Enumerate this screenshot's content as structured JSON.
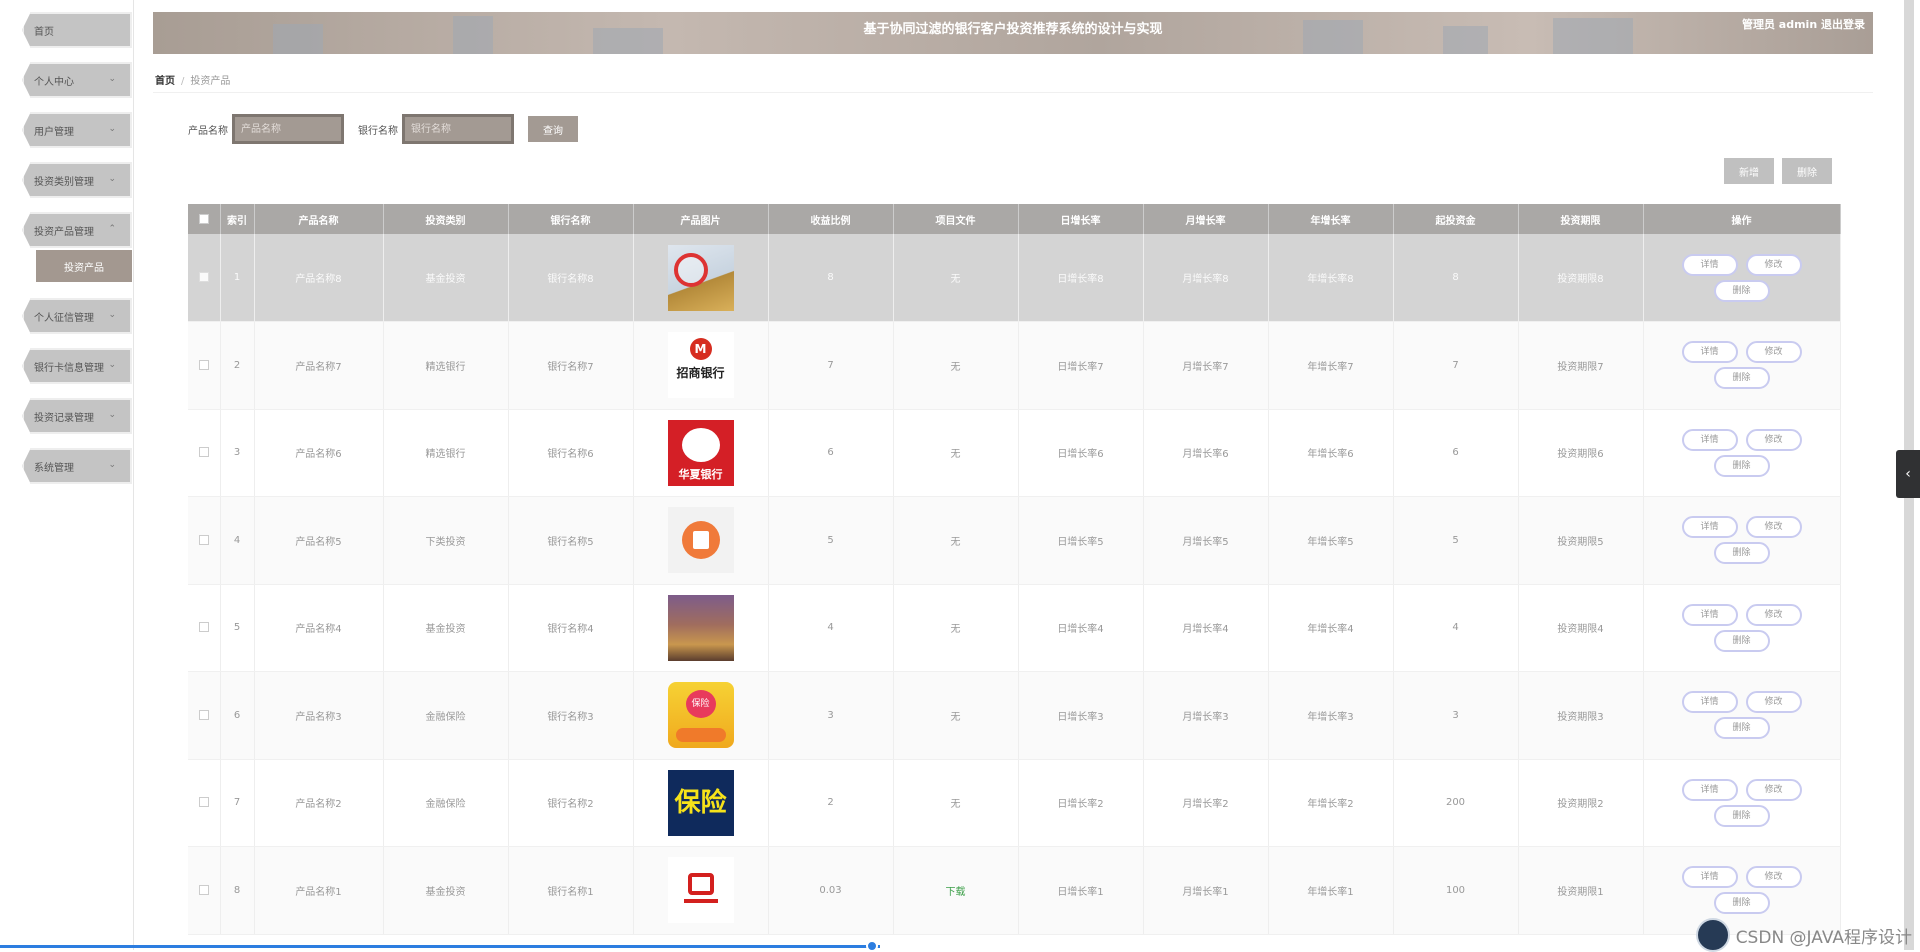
{
  "header": {
    "title": "基于协同过滤的银行客户投资推荐系统的设计与实现",
    "user": "管理员 admin  退出登录"
  },
  "sidebar": {
    "items": [
      {
        "label": "首页",
        "has_chevron": false
      },
      {
        "label": "个人中心",
        "has_chevron": true
      },
      {
        "label": "用户管理",
        "has_chevron": true
      },
      {
        "label": "投资类别管理",
        "has_chevron": true
      },
      {
        "label": "投资产品管理",
        "has_chevron": true,
        "expanded": true
      },
      {
        "label": "个人征信管理",
        "has_chevron": true
      },
      {
        "label": "银行卡信息管理",
        "has_chevron": true
      },
      {
        "label": "投资记录管理",
        "has_chevron": true
      },
      {
        "label": "系统管理",
        "has_chevron": true
      }
    ],
    "sub_item": "投资产品"
  },
  "breadcrumb": {
    "home": "首页",
    "current": "投资产品"
  },
  "search": {
    "product_label": "产品名称",
    "product_placeholder": "产品名称",
    "bank_label": "银行名称",
    "bank_placeholder": "银行名称",
    "button": "查询"
  },
  "toolbar": {
    "add": "新增",
    "delete": "删除"
  },
  "table": {
    "headers": [
      "索引",
      "产品名称",
      "投资类别",
      "银行名称",
      "产品图片",
      "收益比例",
      "项目文件",
      "日增长率",
      "月增长率",
      "年增长率",
      "起投资金",
      "投资期限",
      "操作"
    ],
    "actions": {
      "detail": "详情",
      "edit": "修改",
      "delete": "删除"
    },
    "rows": [
      {
        "index": "1",
        "name": "产品名称8",
        "category": "基金投资",
        "bank": "银行名称8",
        "image": "coins-image",
        "ratio": "8",
        "file": "无",
        "daily": "日增长率8",
        "monthly": "月增长率8",
        "yearly": "年增长率8",
        "min": "8",
        "term": "投资期限8"
      },
      {
        "index": "2",
        "name": "产品名称7",
        "category": "精选银行",
        "bank": "银行名称7",
        "image": "cmb-logo",
        "ratio": "7",
        "file": "无",
        "daily": "日增长率7",
        "monthly": "月增长率7",
        "yearly": "年增长率7",
        "min": "7",
        "term": "投资期限7"
      },
      {
        "index": "3",
        "name": "产品名称6",
        "category": "精选银行",
        "bank": "银行名称6",
        "image": "hxb-logo",
        "ratio": "6",
        "file": "无",
        "daily": "日增长率6",
        "monthly": "月增长率6",
        "yearly": "年增长率6",
        "min": "6",
        "term": "投资期限6"
      },
      {
        "index": "4",
        "name": "产品名称5",
        "category": "下类投资",
        "bank": "银行名称5",
        "image": "orange-app-icon",
        "ratio": "5",
        "file": "无",
        "daily": "日增长率5",
        "monthly": "月增长率5",
        "yearly": "年增长率5",
        "min": "5",
        "term": "投资期限5"
      },
      {
        "index": "5",
        "name": "产品名称4",
        "category": "基金投资",
        "bank": "银行名称4",
        "image": "coins-stack-image",
        "ratio": "4",
        "file": "无",
        "daily": "日增长率4",
        "monthly": "月增长率4",
        "yearly": "年增长率4",
        "min": "4",
        "term": "投资期限4"
      },
      {
        "index": "6",
        "name": "产品名称3",
        "category": "金融保险",
        "bank": "银行名称3",
        "image": "insurance-heart-icon",
        "ratio": "3",
        "file": "无",
        "daily": "日增长率3",
        "monthly": "月增长率3",
        "yearly": "年增长率3",
        "min": "3",
        "term": "投资期限3"
      },
      {
        "index": "7",
        "name": "产品名称2",
        "category": "金融保险",
        "bank": "银行名称2",
        "image": "baoxian-text-image",
        "ratio": "2",
        "file": "无",
        "daily": "日增长率2",
        "monthly": "月增长率2",
        "yearly": "年增长率2",
        "min": "200",
        "term": "投资期限2"
      },
      {
        "index": "8",
        "name": "产品名称1",
        "category": "基金投资",
        "bank": "银行名称1",
        "image": "bank-logo-red",
        "ratio": "0.03",
        "file": "下载",
        "daily": "日增长率1",
        "monthly": "月增长率1",
        "yearly": "年增长率1",
        "min": "100",
        "term": "投资期限1"
      }
    ]
  },
  "image_text": {
    "cmb": "招商银行",
    "hxb": "华夏银行",
    "baoxian": "保险",
    "baoxian_small": "保险"
  },
  "watermark": "CSDN @JAVA程序设计",
  "colors": {
    "header_bg": "#b8aca4",
    "accent_button": "#a39a93",
    "table_header": "#aaa8a6",
    "action_border": "#c9cbf0",
    "progress": "#2c7de0"
  }
}
